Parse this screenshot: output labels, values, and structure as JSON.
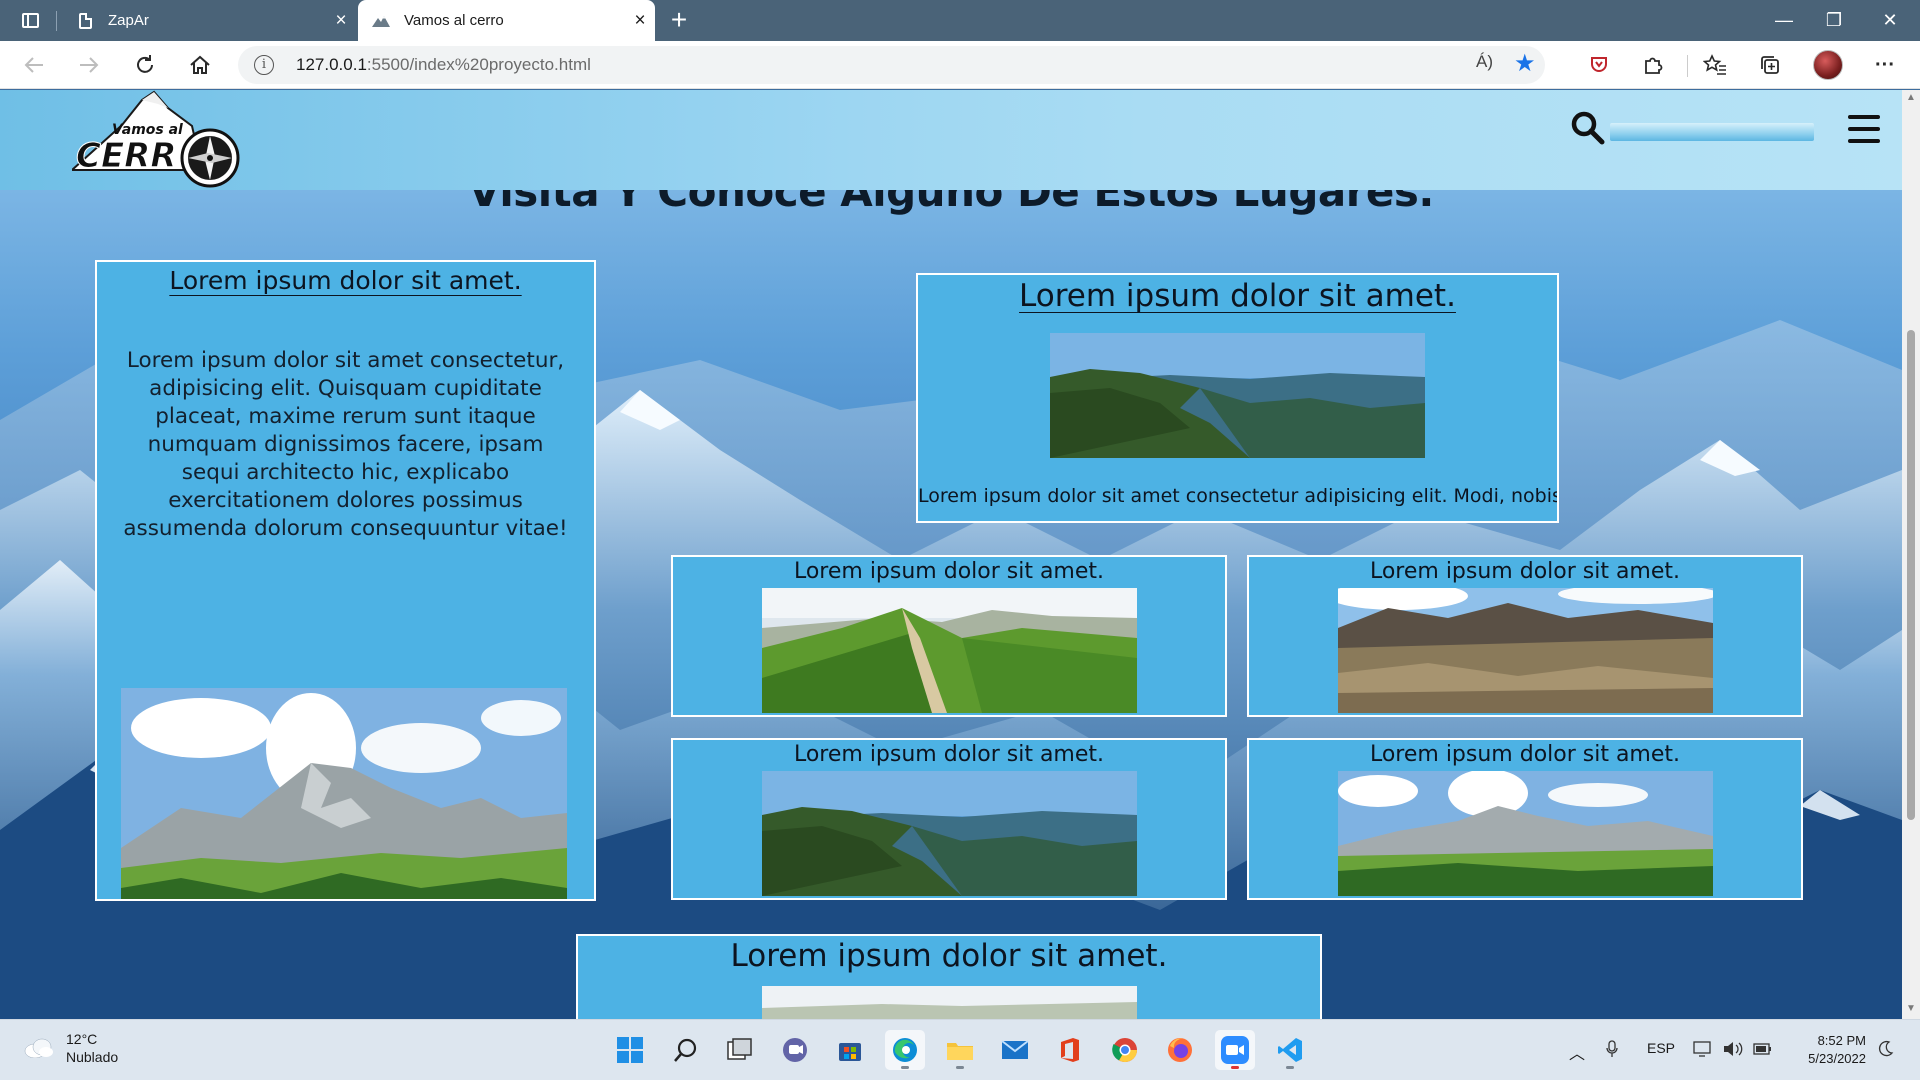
{
  "browser": {
    "tabs": [
      {
        "title": "ZapAr",
        "close_label": "×"
      },
      {
        "title": "Vamos al cerro",
        "close_label": "×"
      }
    ],
    "new_tab_label": "+",
    "window_controls": {
      "minimize": "—",
      "restore": "❐",
      "close": "✕"
    },
    "address": {
      "host": "127.0.0.1",
      "rest": ":5500/index%20proyecto.html"
    },
    "read_aloud_label": "Á)",
    "more_label": "···"
  },
  "site": {
    "logo": {
      "top_text": "Vamos al",
      "main_text": "CERR"
    },
    "heading": "Visita Y Conoce Alguno De Estos Lugares.",
    "feature_card": {
      "title": "Lorem ipsum dolor sit amet.",
      "body": "Lorem ipsum dolor sit amet consectetur, adipisicing elit. Quisquam cupiditate placeat, maxime rerum sunt itaque numquam dignissimos facere, ipsam sequi architecto hic, explicabo exercitationem dolores possimus assumenda dolorum consequuntur vitae!"
    },
    "top_card": {
      "title": "Lorem ipsum dolor sit amet.",
      "caption": "Lorem ipsum dolor sit amet consectetur adipisicing elit. Modi, nobis!"
    },
    "grid_cards": [
      {
        "title": "Lorem ipsum dolor sit amet."
      },
      {
        "title": "Lorem ipsum dolor sit amet."
      },
      {
        "title": "Lorem ipsum dolor sit amet."
      },
      {
        "title": "Lorem ipsum dolor sit amet."
      }
    ],
    "bottom_card": {
      "title": "Lorem ipsum dolor sit amet."
    }
  },
  "taskbar": {
    "weather": {
      "temp": "12°C",
      "condition": "Nublado"
    },
    "language": "ESP",
    "time": "8:52 PM",
    "date": "5/23/2022"
  },
  "colors": {
    "card_bg": "#4db2e4",
    "card_border": "#ffffff",
    "accent_blue": "#1a73e8",
    "tabbar": "#4a6378"
  }
}
